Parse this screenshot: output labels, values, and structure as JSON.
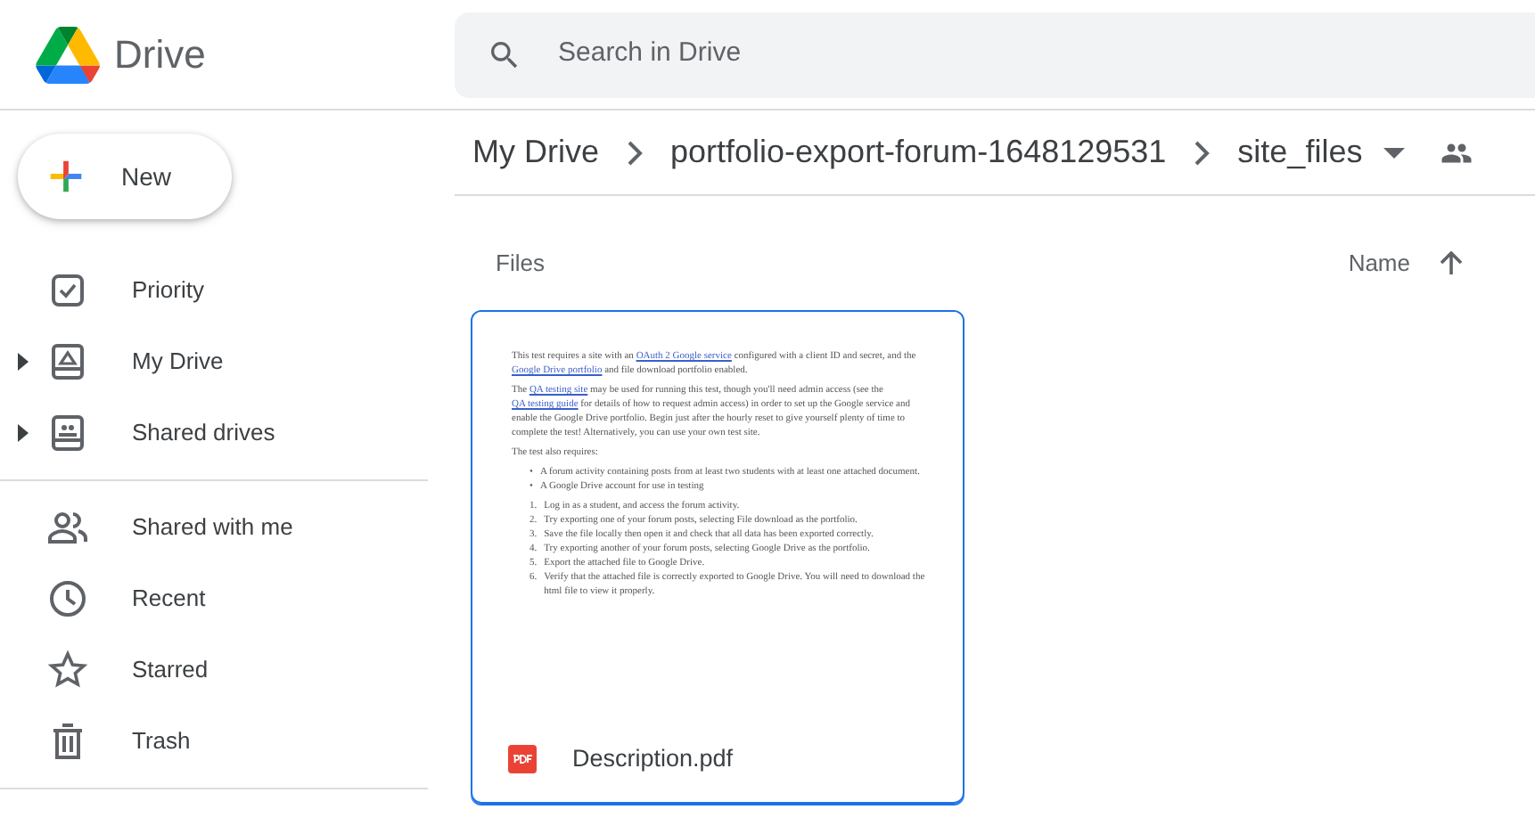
{
  "app": {
    "title": "Drive"
  },
  "search": {
    "placeholder": "Search in Drive"
  },
  "new_button": {
    "label": "New"
  },
  "sidebar": {
    "sections": [
      {
        "items": [
          {
            "label": "Priority",
            "expandable": false,
            "selected": false
          },
          {
            "label": "My Drive",
            "expandable": true,
            "selected": false
          },
          {
            "label": "Shared drives",
            "expandable": true,
            "selected": false
          }
        ]
      },
      {
        "items": [
          {
            "label": "Shared with me",
            "expandable": false,
            "selected": false
          },
          {
            "label": "Recent",
            "expandable": false,
            "selected": false
          },
          {
            "label": "Starred",
            "expandable": false,
            "selected": false
          },
          {
            "label": "Trash",
            "expandable": false,
            "selected": false
          }
        ]
      }
    ]
  },
  "breadcrumb": [
    "My Drive",
    "portfolio-export-forum-1648129531",
    "site_files"
  ],
  "section_label": "Files",
  "sort": {
    "label": "Name",
    "ascending": true
  },
  "files": [
    {
      "name": "Description.pdf",
      "selected": true,
      "preview": [
        {
          "kind": "paragraph",
          "parts": [
            {
              "text": "This test requires a site with an ",
              "link": false
            },
            {
              "text": "OAuth 2 Google service",
              "link": true
            },
            {
              "text": " configured with a client ID and secret, and the ",
              "link": false
            },
            {
              "text": "Google Drive portfolio",
              "link": true
            },
            {
              "text": " and file download portfolio enabled.",
              "link": false
            }
          ]
        },
        {
          "kind": "paragraph",
          "parts": [
            {
              "text": "The ",
              "link": false
            },
            {
              "text": "QA testing site",
              "link": true
            },
            {
              "text": " may be used for running this test, though you'll need admin access (see the ",
              "link": false
            },
            {
              "text": "QA testing guide",
              "link": true
            },
            {
              "text": " for details of how to request admin access) in order to set up the Google service and enable the Google Drive portfolio. Begin just after the hourly reset to give yourself plenty of time to complete the test! Alternatively, you can use your own test site.",
              "link": false
            }
          ]
        },
        {
          "kind": "paragraph",
          "parts": [
            {
              "text": "The test also requires:",
              "link": false
            }
          ]
        },
        {
          "kind": "list",
          "items": [
            {
              "marker": "•",
              "text": "A forum activity containing posts from at least two students with at least one attached document."
            },
            {
              "marker": "•",
              "text": "A Google Drive account for use in testing"
            }
          ]
        },
        {
          "kind": "list",
          "items": [
            {
              "marker": "1.",
              "text": "Log in as a student, and access the forum activity."
            },
            {
              "marker": "2.",
              "text": "Try exporting one of your forum posts, selecting File download as the portfolio."
            },
            {
              "marker": "3.",
              "text": "Save the file locally then open it and check that all data has been exported correctly."
            },
            {
              "marker": "4.",
              "text": "Try exporting another of your forum posts, selecting Google Drive as the portfolio."
            },
            {
              "marker": "5.",
              "text": "Export the attached file to Google Drive."
            },
            {
              "marker": "6.",
              "text": "Verify that the attached file is correctly exported to Google Drive. You will need to download the html file to view it properly."
            }
          ]
        }
      ]
    }
  ]
}
